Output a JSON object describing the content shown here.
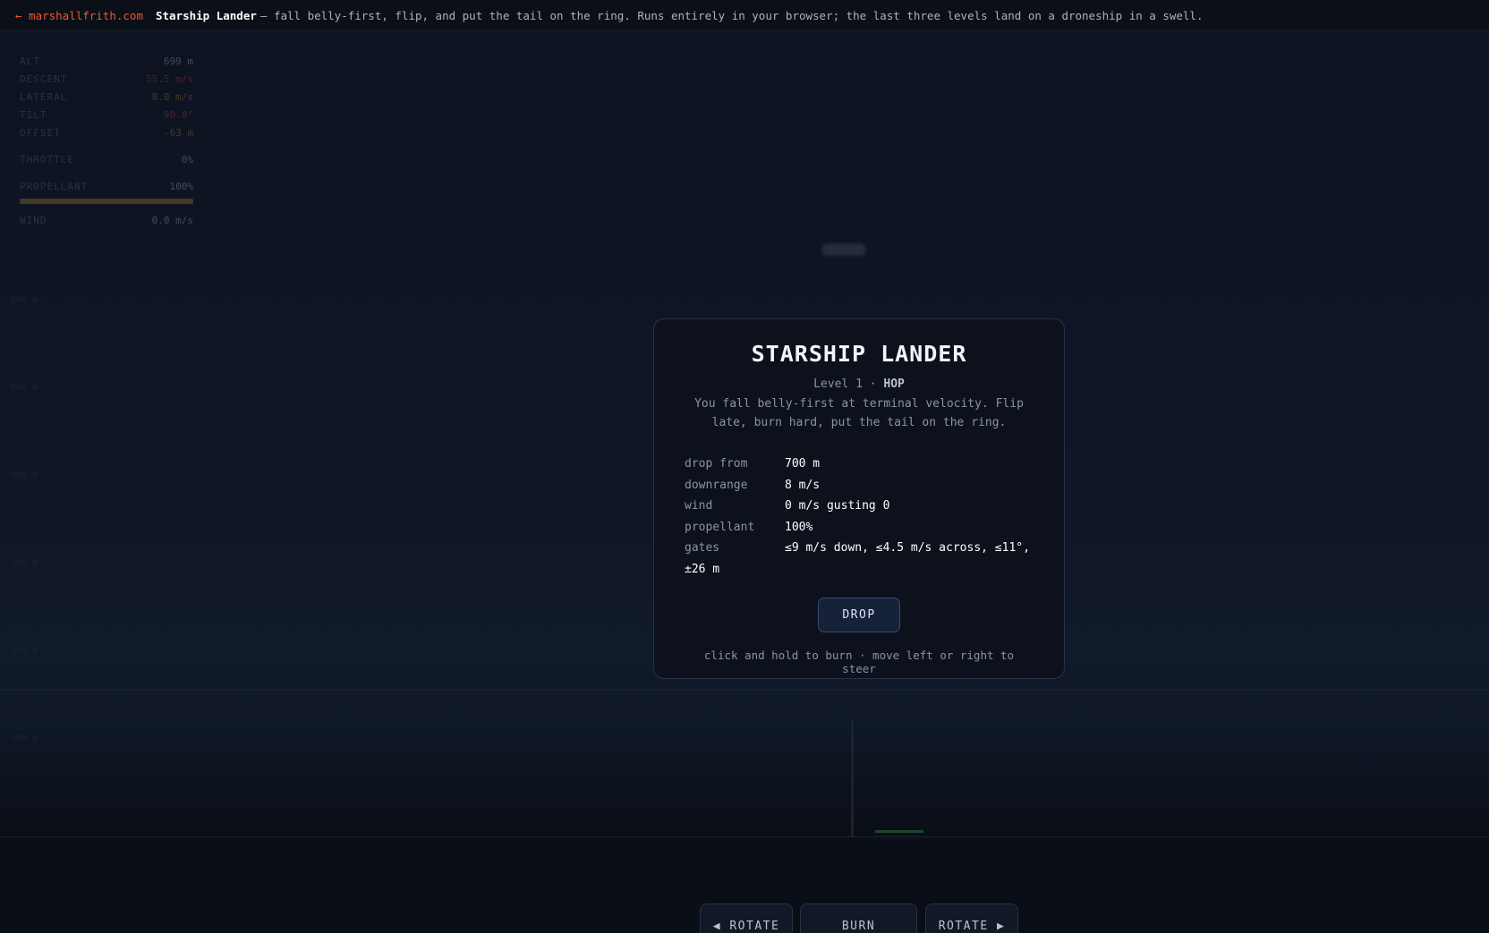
{
  "topbar": {
    "back_link": "← marshallfrith.com",
    "app_name": "Starship Lander",
    "tagline": "— fall belly-first, flip, and put the tail on the ring. Runs entirely in your browser; the last three levels land on a droneship in a swell."
  },
  "hud": {
    "alt": {
      "label": "ALT",
      "value": "699 m"
    },
    "descent": {
      "label": "DESCENT",
      "value": "55.5 m/s"
    },
    "lateral": {
      "label": "LATERAL",
      "value": "8.0 m/s"
    },
    "tilt": {
      "label": "TILT",
      "value": "90.0°"
    },
    "offset": {
      "label": "OFFSET",
      "value": "-63 m"
    },
    "throttle": {
      "label": "THROTTLE",
      "value": "0%"
    },
    "propellant": {
      "label": "PROPELLANT",
      "value": "100%",
      "fraction": 1.0
    },
    "wind": {
      "label": "WIND",
      "value": "0.0 m/s"
    }
  },
  "altitude_ticks": [
    "600 m",
    "500 m",
    "400 m",
    "300 m",
    "200 m",
    "100 m"
  ],
  "modal": {
    "title": "STARSHIP LANDER",
    "level_prefix": "Level 1 ·",
    "level_name": "HOP",
    "description": "You fall belly-first at terminal velocity. Flip late, burn hard, put the tail on the ring.",
    "specs": [
      {
        "label": "drop from",
        "value": "700 m"
      },
      {
        "label": "downrange",
        "value": "8 m/s"
      },
      {
        "label": "wind",
        "value": "0 m/s gusting 0"
      },
      {
        "label": "propellant",
        "value": "100%"
      },
      {
        "label": "gates",
        "value": "≤9 m/s down, ≤4.5 m/s across, ≤11°, ±26 m"
      }
    ],
    "drop_button": "DROP",
    "hint": "click and hold to burn · move left or right to steer"
  },
  "controls": {
    "rotate_left": "◀ ROTATE",
    "burn": "BURN",
    "rotate_right": "ROTATE ▶"
  },
  "colors": {
    "accent": "#f0562e",
    "warning": "#d89a2b",
    "danger": "#e5484d",
    "pad": "#1a4a2e"
  }
}
